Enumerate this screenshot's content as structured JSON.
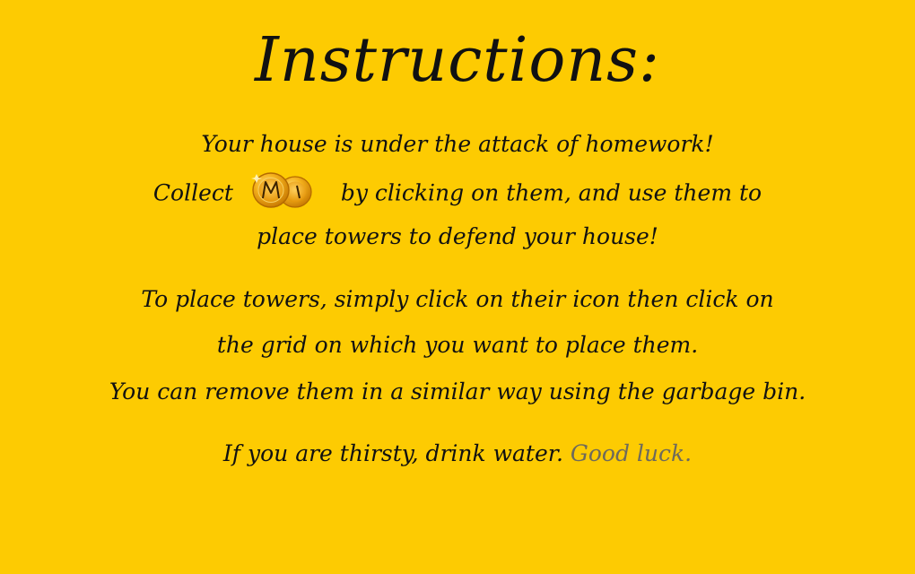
{
  "title": "Instructions:",
  "instructions": {
    "line1": "Your house is under the attack of homework!",
    "line2_prefix": "Collect",
    "coin_icon": "coin-icon",
    "line2_suffix": "by clicking on them, and use them to",
    "line3": "place towers to defend your house!",
    "line4": "To place towers, simply click on their icon then click on",
    "line5": "the grid on which you want to place them.",
    "line6": "You can remove them in a similar way using the garbage bin.",
    "line7_main": "If you are thirsty, drink water.",
    "line7_highlight": "Good luck."
  },
  "colors": {
    "background": "#fdcb02",
    "text": "#111111",
    "highlight": "#6e6a5c",
    "coin": "#f4a81c"
  }
}
